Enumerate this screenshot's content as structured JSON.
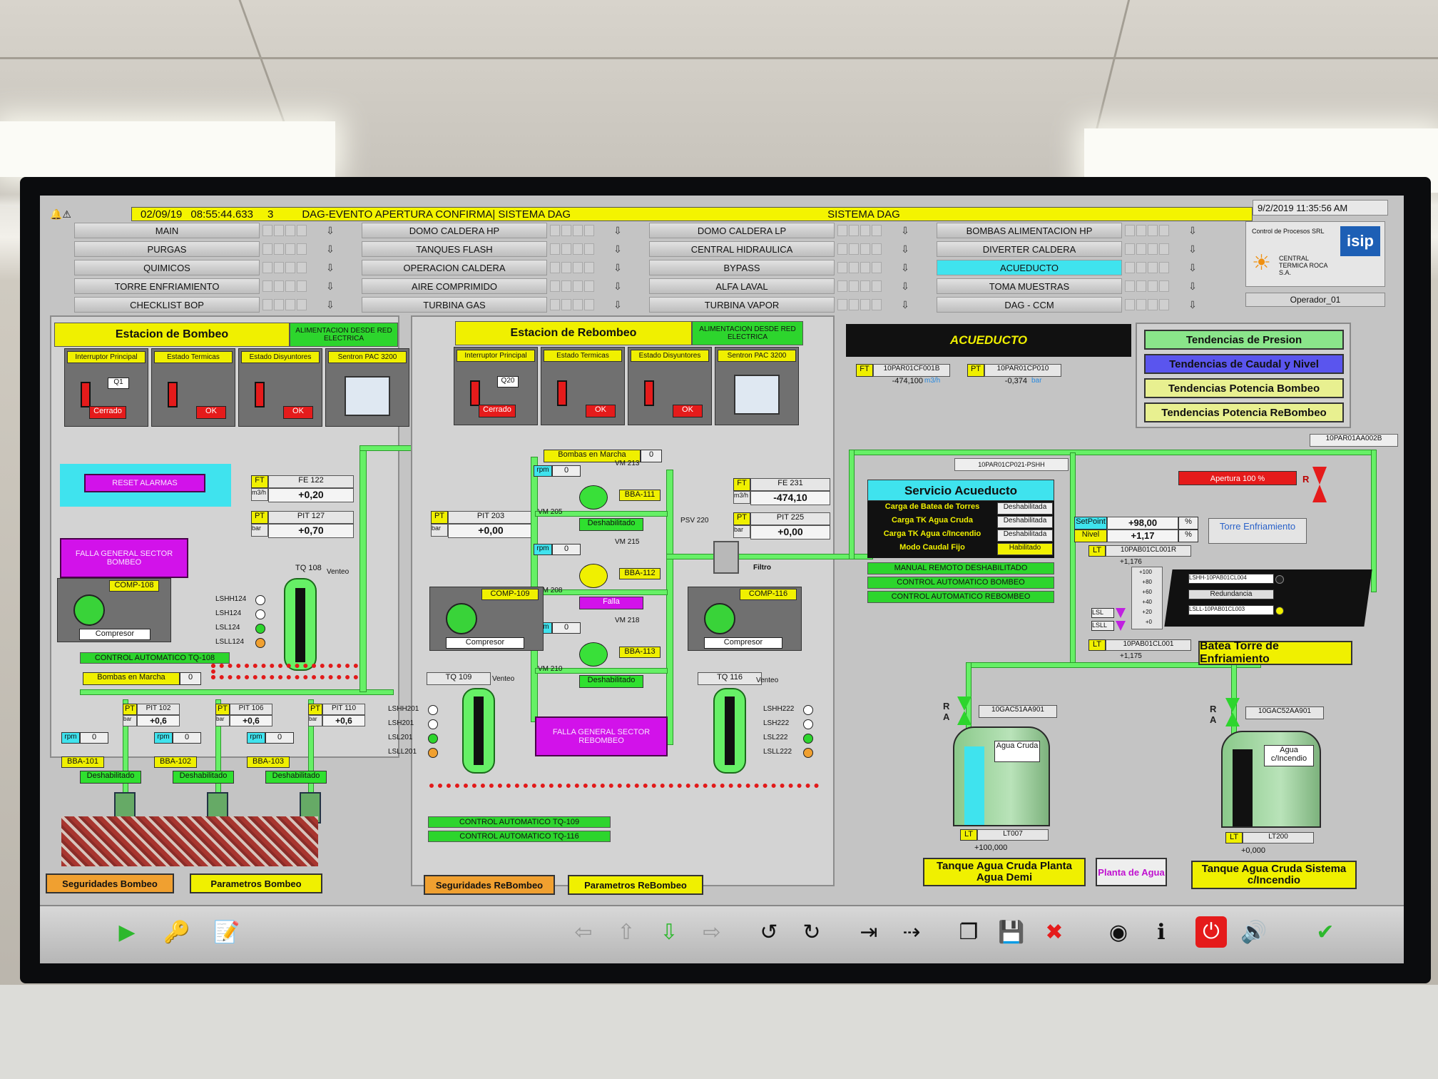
{
  "alarm": {
    "date": "02/09/19",
    "time": "08:55:44.633",
    "count": "3",
    "message": "DAG-EVENTO APERTURA CONFIRMA| SISTEMA DAG",
    "system": "SISTEMA DAG"
  },
  "clock": "9/2/2019 11:35:56 AM",
  "operator": "Operador_01",
  "logo": {
    "company": "Control de Procesos SRL",
    "plant": "CENTRAL TERMICA ROCA S.A.",
    "brand": "isip"
  },
  "nav": {
    "col1": [
      "MAIN",
      "PURGAS",
      "QUIMICOS",
      "TORRE ENFRIAMIENTO",
      "CHECKLIST BOP"
    ],
    "col2": [
      "DOMO CALDERA HP",
      "TANQUES FLASH",
      "OPERACION CALDERA",
      "AIRE COMPRIMIDO",
      "TURBINA GAS"
    ],
    "col3": [
      "DOMO CALDERA LP",
      "CENTRAL HIDRAULICA",
      "BYPASS",
      "ALFA LAVAL",
      "TURBINA VAPOR"
    ],
    "col4": [
      "BOMBAS ALIMENTACION HP",
      "DIVERTER CALDERA",
      "ACUEDUCTO",
      "TOMA MUESTRAS",
      "DAG - CCM"
    ]
  },
  "bombeo": {
    "title": "Estacion de Bombeo",
    "alim": "ALIMENTACION DESDE RED ELECTRICA",
    "tiles": [
      "Interruptor Principal",
      "Estado Termicas",
      "Estado Disyuntores",
      "Sentron PAC 3200"
    ],
    "q": "Q1",
    "state1": "Cerrado",
    "state2": "OK",
    "state3": "OK",
    "reset": "RESET ALARMAS",
    "falla": "FALLA GENERAL SECTOR BOMBEO",
    "ft_tag": "FT",
    "ft_name": "FE 122",
    "ft_unit": "m3/h",
    "ft_val": "+0,20",
    "pt_tag": "PT",
    "pt_name": "PIT 127",
    "pt_unit": "bar",
    "pt_val": "+0,70",
    "tq": "TQ 108",
    "venteo": "Venteo",
    "comp": "COMP-108",
    "compresor": "Compresor",
    "lsh": [
      "LSHH124",
      "LSH124",
      "LSL124",
      "LSLL124"
    ],
    "ctrl": "CONTROL AUTOMATICO TQ-108",
    "bombas_label": "Bombas en Marcha",
    "bombas_val": "0",
    "pumps": [
      {
        "pit": "PIT 102",
        "val": "+0,6",
        "rpm": "0",
        "name": "BBA-101",
        "state": "Deshabilitado"
      },
      {
        "pit": "PIT 106",
        "val": "+0,6",
        "rpm": "0",
        "name": "BBA-102",
        "state": "Deshabilitado"
      },
      {
        "pit": "PIT 110",
        "val": "+0,6",
        "rpm": "0",
        "name": "BBA-103",
        "state": "Deshabilitado"
      }
    ],
    "bar": "bar",
    "rpm": "rpm",
    "pt": "PT",
    "seg": "Seguridades Bombeo",
    "par": "Parametros Bombeo"
  },
  "rebombeo": {
    "title": "Estacion de Rebombeo",
    "alim": "ALIMENTACION DESDE RED ELECTRICA",
    "tiles": [
      "Interruptor Principal",
      "Estado Termicas",
      "Estado Disyuntores",
      "Sentron PAC 3200"
    ],
    "q": "Q20",
    "state1": "Cerrado",
    "state2": "OK",
    "state3": "OK",
    "bombas_label": "Bombas en Marcha",
    "bombas_val": "0",
    "pt_name": "PIT 203",
    "pt_val": "+0,00",
    "ft_name": "FE 231",
    "ft_val": "-474,10",
    "pt2_name": "PIT 225",
    "pt2_val": "+0,00",
    "psv": "PSV 220",
    "filtro": "Filtro",
    "pumps": [
      {
        "rpm": "0",
        "vm_a": "VM 213",
        "vm_b": "VM 205",
        "name": "BBA-111",
        "state": "Deshabilitado"
      },
      {
        "rpm": "0",
        "vm_a": "VM 215",
        "vm_b": "VM 208",
        "name": "BBA-112",
        "state": "Falla"
      },
      {
        "rpm": "0",
        "vm_a": "VM 218",
        "vm_b": "VM 210",
        "name": "BBA-113",
        "state": "Deshabilitado"
      }
    ],
    "comp1": "COMP-109",
    "comp2": "COMP-116",
    "compresor": "Compresor",
    "tq1": "TQ 109",
    "tq2": "TQ 116",
    "venteo": "Venteo",
    "lsh1": [
      "LSHH201",
      "LSH201",
      "LSL201",
      "LSLL201"
    ],
    "lsh2": [
      "LSHH222",
      "LSH222",
      "LSL222",
      "LSLL222"
    ],
    "falla": "FALLA GENERAL SECTOR REBOMBEO",
    "ctrl1": "CONTROL AUTOMATICO TQ-109",
    "ctrl2": "CONTROL AUTOMATICO TQ-116",
    "seg": "Seguridades ReBombeo",
    "par": "Parametros ReBombeo"
  },
  "acueducto": {
    "title": "ACUEDUCTO",
    "ft": "FT",
    "ft_tag": "10PAR01CF001B",
    "ft_val": "-474,100",
    "ft_unit": "m3/h",
    "pt": "PT",
    "pt_tag": "10PAR01CP010",
    "pt_val": "-0,374",
    "pt_unit": "bar",
    "psh": "10PAR01CP021-PSHH",
    "servicio": "Servicio Acueducto",
    "serv_rows": [
      {
        "k": "Carga de Batea de Torres",
        "v": "Deshabilitada"
      },
      {
        "k": "Carga TK Agua Cruda",
        "v": "Deshabilitada"
      },
      {
        "k": "Carga TK Agua c/Incendio",
        "v": "Deshabilitada"
      },
      {
        "k": "Modo Caudal Fijo",
        "v": "Habilitado"
      }
    ],
    "modes": [
      "MANUAL REMOTO DESHABILITADO",
      "CONTROL AUTOMATICO BOMBEO",
      "CONTROL AUTOMATICO REBOMBEO"
    ],
    "trends": [
      "Tendencias de Presion",
      "Tendencias de Caudal y Nivel",
      "Tendencias Potencia Bombeo",
      "Tendencias Potencia ReBombeo"
    ],
    "valve_tag": "10PAR01AA002B",
    "apertura": "Apertura 100 %",
    "setpoint_l": "SetPoint",
    "setpoint": "+98,00",
    "nivel_l": "Nivel",
    "nivel": "+1,17",
    "pct": "%",
    "torre": "Torre Enfriamiento",
    "lt": "LT",
    "lt_tag": "10PAB01CL001R",
    "lt_val": "+1,176",
    "lt2_tag": "10PAB01CL001",
    "lt2_val": "+1,175",
    "scale": [
      "+100",
      "+80",
      "+60",
      "+40",
      "+20",
      "+0"
    ],
    "lshh": "LSHH-10PAB01CL004",
    "redund": "Redundancia",
    "lsll": "LSLL-10PAB01CL003",
    "lsl": "LSL",
    "lsll_s": "LSLL",
    "batea": "Batea Torre de Enfriamiento",
    "v1": "10GAC51AA901",
    "v2": "10GAC52AA901",
    "tk1": "Agua Cruda",
    "tk2": "Agua c/Incendio",
    "lt007": "LT007",
    "lt007_val": "+100,000",
    "lt200": "LT200",
    "lt200_val": "+0,000",
    "tk1_title": "Tanque Agua Cruda Planta Agua Demi",
    "planta": "Planta de Agua",
    "tk2_title": "Tanque Agua Cruda Sistema c/Incendio"
  },
  "colors": {
    "yellow": "#f0f000",
    "green": "#2dd52d",
    "pipe": "#66f066",
    "magenta": "#d212ea",
    "red": "#e51b1b",
    "cyan": "#3fe3ee"
  },
  "toolbar": [
    "play-icon",
    "key-icon",
    "note-icon",
    "arrow-left-icon",
    "arrow-up-icon",
    "arrow-down-icon",
    "arrow-right-icon",
    "undo-icon",
    "redo-icon",
    "import-icon",
    "export-icon",
    "copy-icon",
    "save-icon",
    "delete-icon",
    "view-icon",
    "info-icon",
    "power-icon",
    "sound-icon",
    "ack-icon"
  ]
}
